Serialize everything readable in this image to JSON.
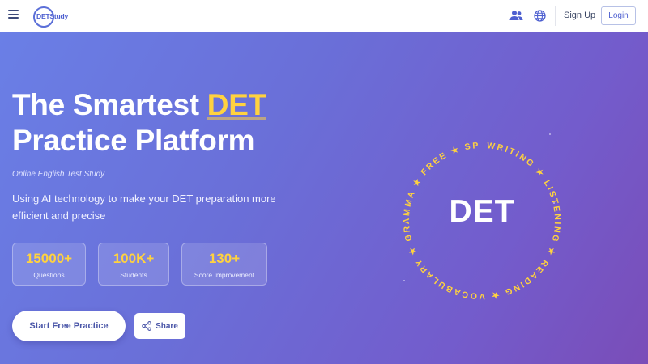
{
  "header": {
    "logo_text": "DETStudy",
    "signup_label": "Sign Up",
    "login_label": "Login"
  },
  "hero": {
    "title_line1_prefix": "The Smartest ",
    "title_accent": "DET",
    "title_line2": "Practice Platform",
    "tagline": "Online English Test Study",
    "description": "Using AI technology to make your DET preparation more efficient and precise",
    "stats": [
      {
        "value": "15000+",
        "label": "Questions"
      },
      {
        "value": "100K+",
        "label": "Students"
      },
      {
        "value": "130+",
        "label": "Score Improvement"
      }
    ],
    "start_label": "Start Free Practice",
    "share_label": "Share"
  },
  "ring": {
    "center_text": "DET",
    "ring_text": "★ WRITING ★ LISTENING ★ READING ★ VOCABULARY ★ GRAMMA ★ FREE ★ SPEAKING ",
    "accent_color": "#ffd23f"
  },
  "colors": {
    "accent": "#ffd23f",
    "brand": "#4d5fd0",
    "gradient_start": "#6a7fe6",
    "gradient_end": "#7a4db8"
  }
}
